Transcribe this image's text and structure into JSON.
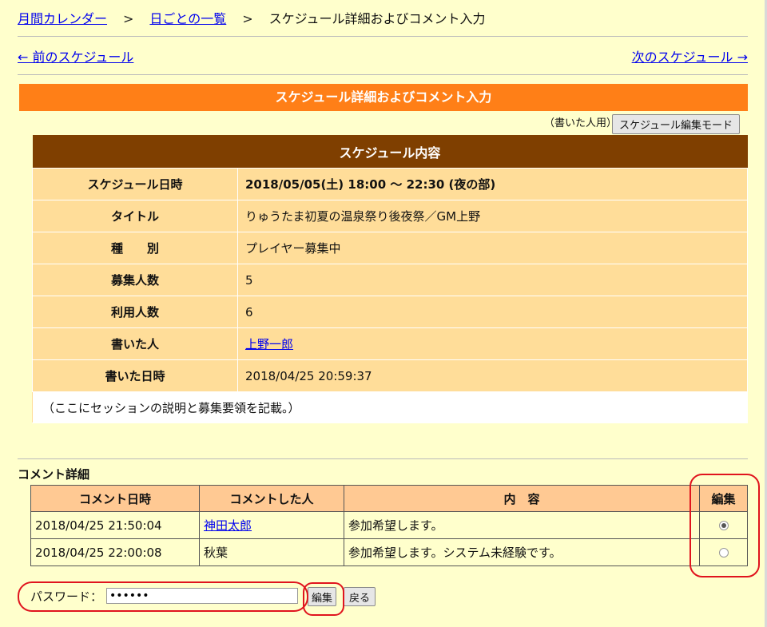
{
  "breadcrumb": {
    "monthly": "月間カレンダー",
    "sep": ">",
    "daily": "日ごとの一覧",
    "current": "スケジュール詳細およびコメント入力"
  },
  "nav": {
    "prev": "← 前のスケジュール",
    "next": "次のスケジュール →"
  },
  "title": "スケジュール詳細およびコメント入力",
  "writer_note": "（書いた人用）",
  "edit_mode_button": "スケジュール編集モード",
  "schedule": {
    "heading": "スケジュール内容",
    "rows": [
      {
        "label": "スケジュール日時",
        "value": "2018/05/05(土) 18:00 ～ 22:30 (夜の部)"
      },
      {
        "label": "タイトル",
        "value": "りゅうたま初夏の温泉祭り後夜祭／GM上野"
      },
      {
        "label": "種　　別",
        "value": "プレイヤー募集中"
      },
      {
        "label": "募集人数",
        "value": "5"
      },
      {
        "label": "利用人数",
        "value": "6"
      },
      {
        "label": "書いた人",
        "value": "上野一郎"
      },
      {
        "label": "書いた日時",
        "value": "2018/04/25 20:59:37"
      }
    ],
    "description": "（ここにセッションの説明と募集要領を記載。）"
  },
  "comments": {
    "heading": "コメント詳細",
    "columns": [
      "コメント日時",
      "コメントした人",
      "内　容",
      "編集"
    ],
    "rows": [
      {
        "date": "2018/04/25 21:50:04",
        "person": "神田太郎",
        "content": "参加希望します。",
        "selected": true
      },
      {
        "date": "2018/04/25 22:00:08",
        "person": "秋葉",
        "content": "参加希望します。システム未経験です。",
        "selected": false
      }
    ]
  },
  "password": {
    "label": "パスワード：",
    "value": "••••••"
  },
  "buttons": {
    "edit": "編集",
    "back": "戻る"
  },
  "colors": {
    "page_bg": "#ffffcc",
    "title_bar": "#ff7f17",
    "schedule_header": "#7f3f00",
    "schedule_cell": "#ffdd99",
    "comment_header": "#ffc993",
    "annotation": "#e0141e"
  }
}
